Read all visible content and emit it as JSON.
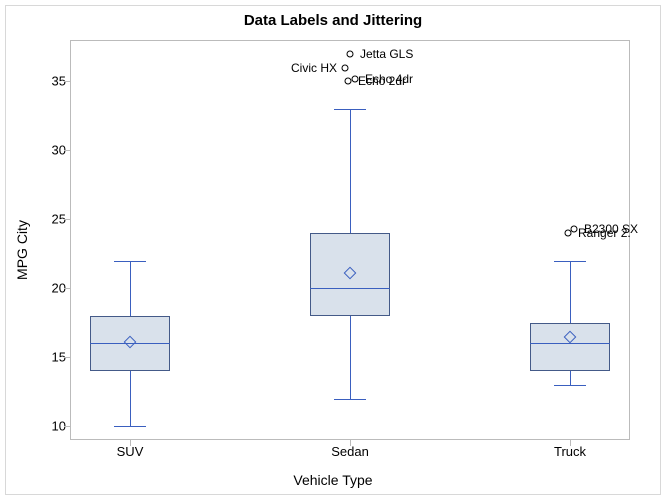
{
  "chart_data": {
    "type": "boxplot",
    "title": "Data Labels and Jittering",
    "xlabel": "Vehicle Type",
    "ylabel": "MPG City",
    "ylim": [
      9,
      38
    ],
    "yticks": [
      10,
      15,
      20,
      25,
      30,
      35
    ],
    "categories": [
      "SUV",
      "Sedan",
      "Truck"
    ],
    "series": [
      {
        "name": "SUV",
        "q1": 14,
        "median": 16,
        "q3": 18,
        "whisker_low": 10,
        "whisker_high": 22,
        "mean": 16.1,
        "outliers": []
      },
      {
        "name": "Sedan",
        "q1": 18,
        "median": 20,
        "q3": 24,
        "whisker_low": 12,
        "whisker_high": 33,
        "mean": 21.1,
        "outliers": [
          {
            "label": "Jetta GLS",
            "value": 37,
            "side": "right",
            "jitter": 0
          },
          {
            "label": "Civic HX",
            "value": 36,
            "side": "left",
            "jitter": -5
          },
          {
            "label": "Echo 4dr",
            "value": 35.2,
            "side": "right",
            "jitter": 5
          },
          {
            "label": "Echo 2dr",
            "value": 35,
            "side": "right",
            "jitter": -2
          }
        ]
      },
      {
        "name": "Truck",
        "q1": 14,
        "median": 16,
        "q3": 17.5,
        "whisker_low": 13,
        "whisker_high": 22,
        "mean": 16.5,
        "outliers": [
          {
            "label": "B2300 SX",
            "value": 24.3,
            "side": "right",
            "jitter": 4
          },
          {
            "label": "Ranger 2.",
            "value": 24,
            "side": "right",
            "jitter": -2
          }
        ]
      }
    ]
  }
}
